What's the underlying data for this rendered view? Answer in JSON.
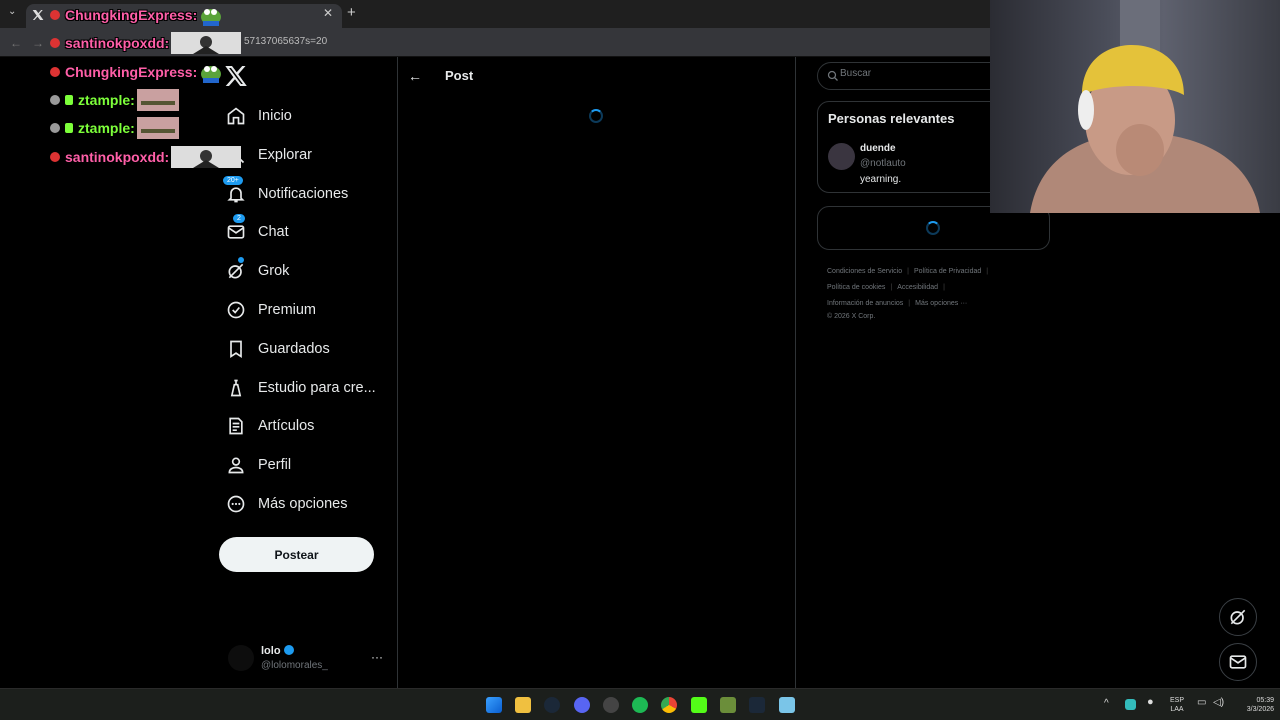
{
  "browser": {
    "new_tab": "+",
    "url_fragment": "57137065637s=20"
  },
  "nav": {
    "items": [
      {
        "label": "Inicio",
        "icon": "home-icon"
      },
      {
        "label": "Explorar",
        "icon": "search-icon"
      },
      {
        "label": "Notificaciones",
        "icon": "bell-icon",
        "badge": "20+"
      },
      {
        "label": "Chat",
        "icon": "mail-icon",
        "badge": "2"
      },
      {
        "label": "Grok",
        "icon": "grok-icon"
      },
      {
        "label": "Premium",
        "icon": "premium-icon"
      },
      {
        "label": "Guardados",
        "icon": "bookmark-icon"
      },
      {
        "label": "Estudio para cre...",
        "icon": "studio-icon"
      },
      {
        "label": "Artículos",
        "icon": "articles-icon"
      },
      {
        "label": "Perfil",
        "icon": "person-icon"
      },
      {
        "label": "Más opciones",
        "icon": "more-icon"
      }
    ],
    "post_button": "Postear",
    "account": {
      "name": "lolo",
      "handle": "@lolomorales_",
      "more": "···"
    }
  },
  "main": {
    "back": "←",
    "title": "Post"
  },
  "sidebar": {
    "search_placeholder": "Buscar",
    "relevant_title": "Personas relevantes",
    "person": {
      "name": "duende",
      "handle": "@notlauto",
      "bio": "yearning."
    },
    "footer": {
      "terms": "Condiciones de Servicio",
      "privacy": "Política de Privacidad",
      "cookies": "Política de cookies",
      "accessibility": "Accesibilidad",
      "ads": "Información de anuncios",
      "more": "Más opciones ···",
      "copyright": "© 2026 X Corp."
    }
  },
  "chat_overlay": [
    {
      "user": "ChungkingExpress:",
      "color": "#ff5fa8",
      "emote": "frog-emote"
    },
    {
      "user": "santinokpoxdd:",
      "color": "#ff5fa8",
      "emote": "image-emote"
    },
    {
      "user": "ChungkingExpress:",
      "color": "#ff5fa8",
      "emote": "frog-emote"
    },
    {
      "user": "ztample:",
      "color": "#7dff3a",
      "emote": "hands-emote"
    },
    {
      "user": "ztample:",
      "color": "#7dff3a",
      "emote": "hands-emote"
    },
    {
      "user": "santinokpoxdd:",
      "color": "#ff5fa8",
      "emote": "image-emote"
    }
  ],
  "taskbar": {
    "lang": "ESP",
    "layout": "LAA",
    "time": "05:39",
    "date": "3/3/2026"
  },
  "colors": {
    "accent": "#1d9bf0",
    "background": "#000000",
    "border": "#2f3336"
  }
}
